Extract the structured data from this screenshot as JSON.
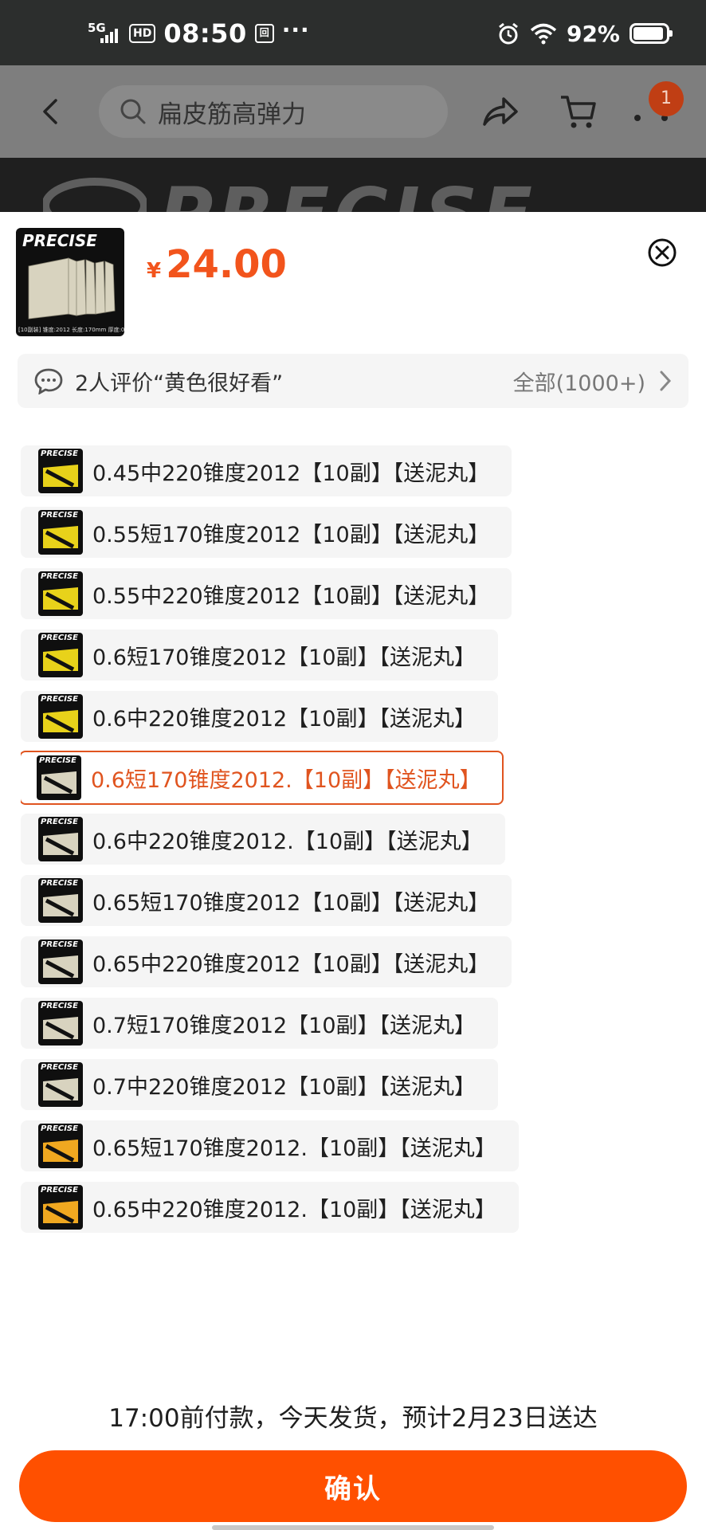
{
  "status_bar": {
    "network": "5G",
    "hd": "HD",
    "time": "08:50",
    "square_icon_text": "回",
    "more": "···",
    "battery_percent": "92%",
    "battery_level": 0.92
  },
  "nav": {
    "search_placeholder": "扁皮筋高弹力",
    "cart_badge": "1"
  },
  "banner": {
    "brand": "PRECISE"
  },
  "product": {
    "thumb_brand": "PRECISE",
    "thumb_caption": "[10副装] 锥度:2012 长度:170mm 厚度:0.6",
    "currency": "¥",
    "price": "24.00"
  },
  "review": {
    "text": "2人评价“黄色很好看”",
    "all": "全部(1000+)"
  },
  "options": [
    {
      "label": "0.45中220锥度2012【10副】【送泥丸】",
      "swatch": "yellow",
      "selected": false
    },
    {
      "label": "0.55短170锥度2012【10副】【送泥丸】",
      "swatch": "yellow",
      "selected": false
    },
    {
      "label": "0.55中220锥度2012【10副】【送泥丸】",
      "swatch": "yellow",
      "selected": false
    },
    {
      "label": "0.6短170锥度2012【10副】【送泥丸】",
      "swatch": "yellow",
      "selected": false
    },
    {
      "label": "0.6中220锥度2012【10副】【送泥丸】",
      "swatch": "yellow",
      "selected": false
    },
    {
      "label": "0.6短170锥度2012.【10副】【送泥丸】",
      "swatch": "cream",
      "selected": true
    },
    {
      "label": "0.6中220锥度2012.【10副】【送泥丸】",
      "swatch": "cream",
      "selected": false
    },
    {
      "label": "0.65短170锥度2012【10副】【送泥丸】",
      "swatch": "cream",
      "selected": false
    },
    {
      "label": "0.65中220锥度2012【10副】【送泥丸】",
      "swatch": "cream",
      "selected": false
    },
    {
      "label": "0.7短170锥度2012【10副】【送泥丸】",
      "swatch": "cream",
      "selected": false
    },
    {
      "label": "0.7中220锥度2012【10副】【送泥丸】",
      "swatch": "cream",
      "selected": false
    },
    {
      "label": "0.65短170锥度2012.【10副】【送泥丸】",
      "swatch": "amber",
      "selected": false
    },
    {
      "label": "0.65中220锥度2012.【10副】【送泥丸】",
      "swatch": "amber",
      "selected": false
    }
  ],
  "footer": {
    "delivery": "17:00前付款，今天发货，预计2月23日送达",
    "confirm_label": "确认"
  },
  "colors": {
    "accent": "#ff5000",
    "price": "#f2541c",
    "selected": "#e0541f",
    "swatch_yellow": "#e8d21a",
    "swatch_cream": "#d8d3bf",
    "swatch_amber": "#f0a820"
  }
}
